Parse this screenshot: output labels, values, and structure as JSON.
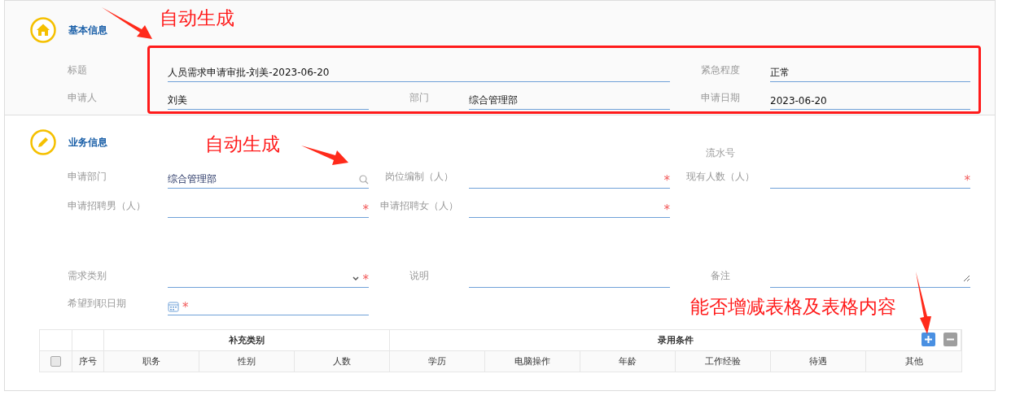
{
  "sections": [
    {
      "title": "基本信息",
      "rows": [
        [
          {
            "label": "标题",
            "value": "人员需求申请审批-刘美-2023-06-20",
            "kind": "text"
          },
          "",
          {
            "label": "紧急程度",
            "value": "正常",
            "kind": "text"
          }
        ],
        [
          {
            "label": "申请人",
            "value": "刘美",
            "kind": "text"
          },
          {
            "label": "部门",
            "value": "综合管理部",
            "kind": "text"
          },
          {
            "label": "申请日期",
            "value": "2023-06-20",
            "kind": "text"
          }
        ]
      ]
    },
    {
      "title": "业务信息",
      "serial_label": "流水号",
      "rows": [
        [
          {
            "label": "申请部门",
            "value": "综合管理部",
            "kind": "search"
          },
          {
            "label": "岗位编制（人）",
            "kind": "text",
            "required_mark": "*"
          },
          {
            "label": "现有人数（人）",
            "kind": "text",
            "required_mark": "*"
          }
        ],
        [
          {
            "label": "申请招聘男（人）",
            "kind": "text",
            "required_mark": "*"
          },
          {
            "label": "申请招聘女（人）",
            "kind": "text",
            "required_mark": "*"
          }
        ],
        [
          {
            "label": "需求类别",
            "kind": "select",
            "required_mark": "*"
          },
          {
            "label": "说明",
            "kind": "text"
          },
          {
            "label": "备注",
            "kind": "textarea"
          }
        ],
        [
          {
            "label": "希望到职日期",
            "kind": "date",
            "required_mark": "*"
          }
        ]
      ]
    }
  ],
  "table": {
    "select_all": {
      "checked": false
    },
    "groups": [
      "补充类别",
      "录用条件"
    ],
    "columns": [
      "序号",
      "职务",
      "性别",
      "人数",
      "学历",
      "电脑操作",
      "年龄",
      "工作经验",
      "待遇",
      "其他"
    ]
  },
  "annotations": [
    "自动生成",
    "自动生成",
    "能否增减表格及表格内容"
  ]
}
